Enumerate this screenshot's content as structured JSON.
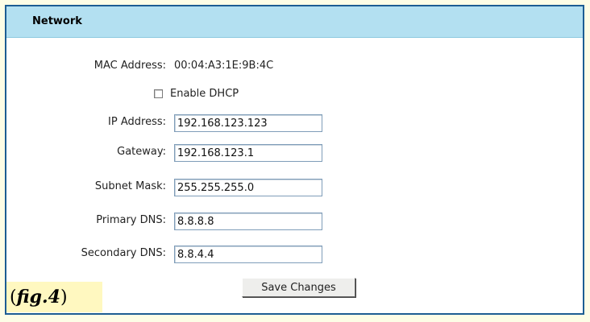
{
  "header": {
    "title": "Network"
  },
  "mac": {
    "label": "MAC Address:",
    "value": "00:04:A3:1E:9B:4C"
  },
  "dhcp": {
    "label": "Enable DHCP",
    "checked": false
  },
  "fields": {
    "ip": {
      "label": "IP Address:",
      "value": "192.168.123.123"
    },
    "gateway": {
      "label": "Gateway:",
      "value": "192.168.123.1"
    },
    "subnet": {
      "label": "Subnet Mask:",
      "value": "255.255.255.0"
    },
    "dns1": {
      "label": "Primary DNS:",
      "value": "8.8.8.8"
    },
    "dns2": {
      "label": "Secondary DNS:",
      "value": "8.8.4.4"
    }
  },
  "actions": {
    "save_label": "Save Changes"
  },
  "caption": {
    "open": "(",
    "text": "fig.4",
    "close": ")"
  },
  "colors": {
    "header_bg": "#b3e0f1",
    "border": "#1d5d93",
    "caption_bg": "#fff8c0"
  }
}
